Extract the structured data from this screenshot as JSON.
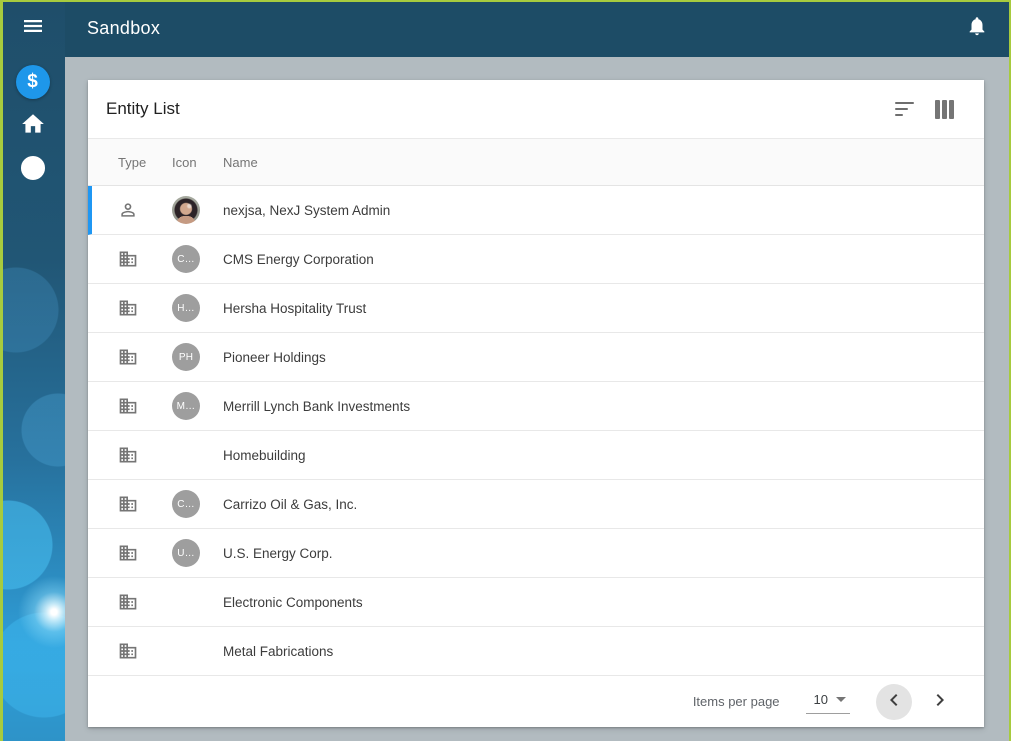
{
  "appbar": {
    "title": "Sandbox",
    "bell_icon": "notifications-icon"
  },
  "sidebar": {
    "menu_icon": "menu-icon",
    "items": [
      {
        "id": "finance",
        "glyph": "$",
        "active": true
      },
      {
        "id": "home",
        "icon": "home-icon"
      },
      {
        "id": "account",
        "icon": "account-circle-icon"
      }
    ]
  },
  "card": {
    "title": "Entity List",
    "toolbar": {
      "sort_icon": "sort-icon",
      "columns_icon": "columns-icon"
    },
    "table": {
      "columns": [
        "Type",
        "Icon",
        "Name"
      ],
      "rows": [
        {
          "type": "person",
          "avatar": "photo",
          "initials": "",
          "name": "nexjsa, NexJ System Admin",
          "selected": true
        },
        {
          "type": "company",
          "avatar": "initials",
          "initials": "C…",
          "name": "CMS Energy Corporation",
          "selected": false
        },
        {
          "type": "company",
          "avatar": "initials",
          "initials": "H…",
          "name": "Hersha Hospitality Trust",
          "selected": false
        },
        {
          "type": "company",
          "avatar": "initials",
          "initials": "PH",
          "name": "Pioneer Holdings",
          "selected": false
        },
        {
          "type": "company",
          "avatar": "initials",
          "initials": "M…",
          "name": "Merrill Lynch Bank Investments",
          "selected": false
        },
        {
          "type": "company",
          "avatar": "none",
          "initials": "",
          "name": "Homebuilding",
          "selected": false
        },
        {
          "type": "company",
          "avatar": "initials",
          "initials": "C…",
          "name": "Carrizo Oil & Gas, Inc.",
          "selected": false
        },
        {
          "type": "company",
          "avatar": "initials",
          "initials": "U…",
          "name": "U.S. Energy Corp.",
          "selected": false
        },
        {
          "type": "company",
          "avatar": "none",
          "initials": "",
          "name": "Electronic Components",
          "selected": false
        },
        {
          "type": "company",
          "avatar": "none",
          "initials": "",
          "name": "Metal Fabrications",
          "selected": false
        }
      ]
    },
    "pagination": {
      "label": "Items per page",
      "value": "10",
      "prev_icon": "chevron-left-icon",
      "next_icon": "chevron-right-icon"
    }
  },
  "colors": {
    "appbar_bg": "#1d4c66",
    "accent_blue": "#1e97ea",
    "selected_bar": "#1f97f3",
    "main_bg": "#b2bbc0",
    "frame_border": "#a7cb3e",
    "avatar_gray": "#9e9e9e"
  }
}
